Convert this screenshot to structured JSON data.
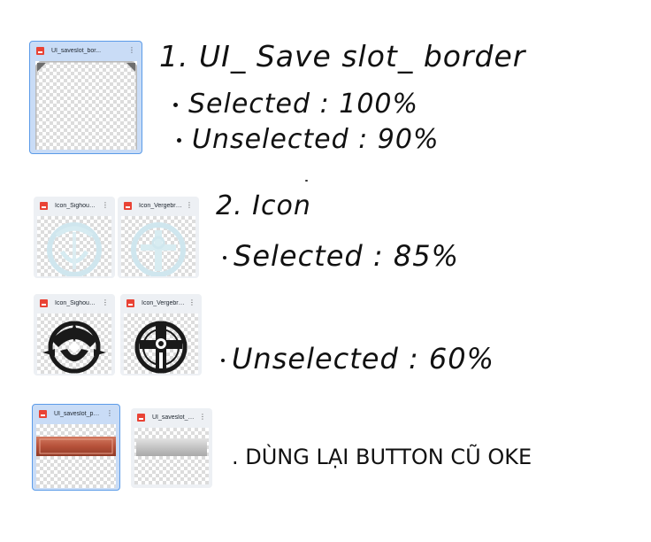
{
  "cards": {
    "save_slot_border": {
      "name": "UI_saveslot_bor..."
    },
    "icon_sighound_selected": {
      "name": "Icon_Sighound..."
    },
    "icon_vergebrand_selected": {
      "name": "Icon_Vergebran..."
    },
    "icon_sighound_unselected": {
      "name": "Icon_Sighound..."
    },
    "icon_vergebrand_unselected": {
      "name": "Icon_Vergebran..."
    },
    "button_selected": {
      "name": "UI_saveslot_pop..."
    },
    "button_unselected": {
      "name": "UI_saveslot_pop..."
    }
  },
  "menu_glyph": "⋮",
  "notes": {
    "section1_title": "1. UI_ Save slot_ border",
    "section1_selected": "Selected : 100%",
    "section1_unselected": "Unselected : 90%",
    "section2_title": "2. Icon",
    "section2_selected": "Selected : 85%",
    "section2_unselected": "Unselected : 60%",
    "section3": ". DÙNG LẠI BUTTON CŨ OKE"
  },
  "colors": {
    "selected_card_bg": "#c9dcf6",
    "selected_card_border": "#5b9be8",
    "card_bg": "#edf0f4",
    "file_icon_red": "#e94335",
    "button_red": "#b6513a",
    "button_gray": "#c4c4c4",
    "icon_glow": "#cfe6ee"
  },
  "icons": [
    "file-image-icon",
    "more-vert-icon",
    "sighound-emblem-icon",
    "vergebrand-emblem-icon"
  ]
}
